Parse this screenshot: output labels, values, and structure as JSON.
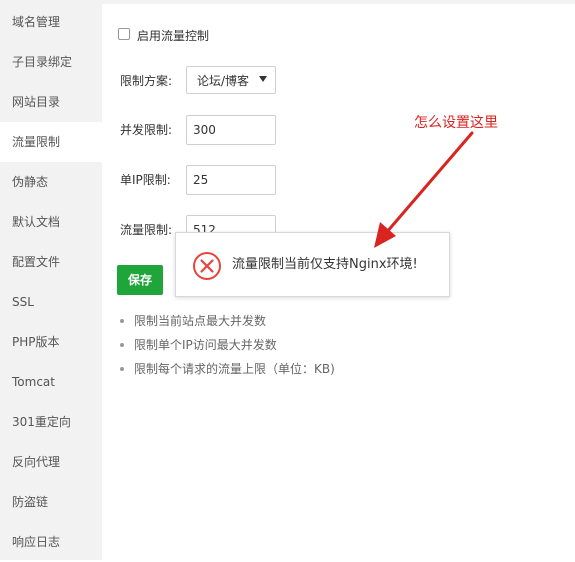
{
  "sidebar": {
    "items": [
      {
        "label": "域名管理"
      },
      {
        "label": "子目录绑定"
      },
      {
        "label": "网站目录"
      },
      {
        "label": "流量限制"
      },
      {
        "label": "伪静态"
      },
      {
        "label": "默认文档"
      },
      {
        "label": "配置文件"
      },
      {
        "label": "SSL"
      },
      {
        "label": "PHP版本"
      },
      {
        "label": "Tomcat"
      },
      {
        "label": "301重定向"
      },
      {
        "label": "反向代理"
      },
      {
        "label": "防盗链"
      },
      {
        "label": "响应日志"
      }
    ]
  },
  "form": {
    "enable_label": "启用流量控制",
    "scheme_label": "限制方案:",
    "scheme_value": "论坛/博客",
    "concurrency_label": "并发限制:",
    "concurrency_value": "300",
    "per_ip_label": "单IP限制:",
    "per_ip_value": "25",
    "traffic_label": "流量限制:",
    "traffic_value": "512",
    "save_label": "保存"
  },
  "tips": [
    "限制当前站点最大并发数",
    "限制单个IP访问最大并发数",
    "限制每个请求的流量上限（单位：KB)"
  ],
  "toast": {
    "message": "流量限制当前仅支持Nginx环境!",
    "icon": "error-circle-icon"
  },
  "annotation": {
    "text": "怎么设置这里"
  },
  "colors": {
    "accent": "#20a53a",
    "error": "#e8433b",
    "annotation": "#d9241f"
  }
}
